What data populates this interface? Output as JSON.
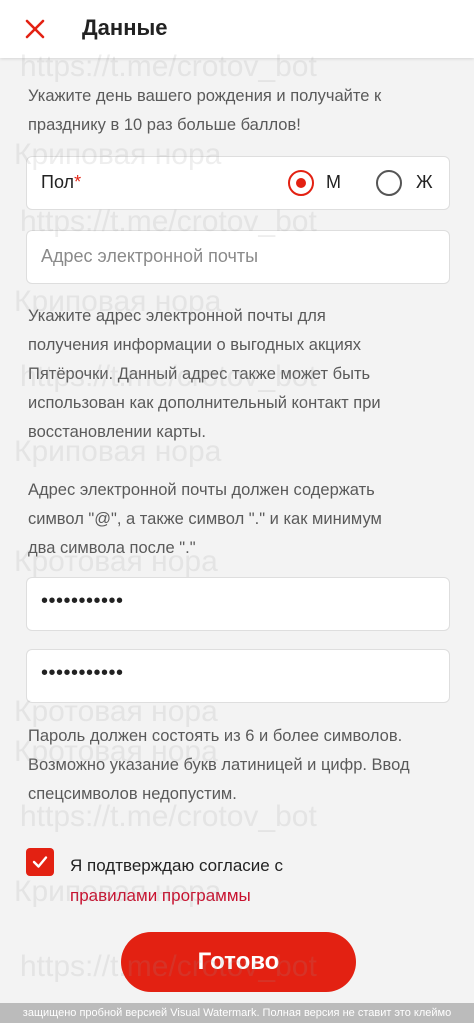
{
  "header": {
    "title": "Данные",
    "close_icon": "close-x-icon"
  },
  "birthday_hint": {
    "line1": "Укажите день вашего рождения и получайте к",
    "line2": "празднику в 10 раз больше баллов!"
  },
  "gender": {
    "label": "Пол",
    "required_mark": "*",
    "options": [
      {
        "label": "М",
        "selected": true
      },
      {
        "label": "Ж",
        "selected": false
      }
    ]
  },
  "email": {
    "placeholder": "Адрес электронной почты"
  },
  "email_hint": {
    "lines": [
      "Укажите адрес электронной почты для",
      "получения информации о выгодных акциях",
      "Пятёрочки. Данный адрес также может быть",
      "использован как дополнительный контакт при",
      "восстановлении карты."
    ]
  },
  "email_rule": {
    "lines": [
      "Адрес электронной почты должен содержать",
      "символ \"@\", а также символ \".\" и как минимум",
      "два символа после \".\""
    ]
  },
  "password": {
    "value": "•••••••••••"
  },
  "password_confirm": {
    "value": "•••••••••••"
  },
  "password_hint": {
    "lines": [
      "Пароль должен состоять из 6 и более символов.",
      "Возможно указание букв латиницей и цифр. Ввод",
      "спецсимволов недопустим."
    ]
  },
  "consent": {
    "checked": true,
    "text": "Я подтверждаю согласие с",
    "link": "правилами программы"
  },
  "submit": {
    "label": "Готово"
  },
  "watermarks": {
    "url": "https://t.me/crotov_bot",
    "name1": "Криповая нора",
    "name2": "Кротовая нора"
  },
  "trial_banner": "защищено пробной версией Visual Watermark. Полная версия не ставит это клеймо",
  "colors": {
    "accent": "#e32112",
    "background": "#f3f3f3"
  }
}
